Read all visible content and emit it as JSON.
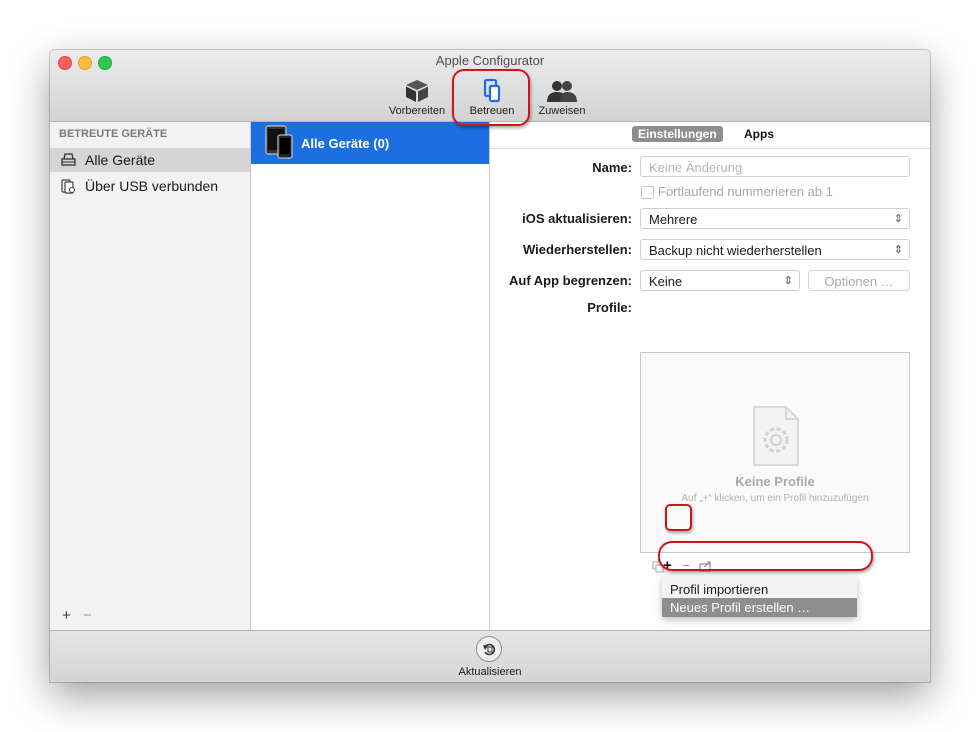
{
  "window": {
    "title": "Apple Configurator"
  },
  "toolbar": {
    "items": [
      {
        "label": "Vorbereiten",
        "icon": "cube-icon"
      },
      {
        "label": "Betreuen",
        "icon": "devices-icon",
        "active": true
      },
      {
        "label": "Zuweisen",
        "icon": "people-icon"
      }
    ]
  },
  "sidebar": {
    "header": "BETREUTE GERÄTE",
    "items": [
      {
        "label": "Alle Geräte",
        "icon": "tray-icon",
        "selected": true
      },
      {
        "label": "Über USB verbunden",
        "icon": "usb-device-icon"
      }
    ],
    "footer": {
      "add": "+",
      "remove": "−"
    }
  },
  "device_list": {
    "selected_row": {
      "label": "Alle Geräte (0)",
      "icon": "ipad-iphone-icon"
    }
  },
  "settings": {
    "tabs": [
      {
        "label": "Einstellungen",
        "selected": true
      },
      {
        "label": "Apps",
        "selected": false
      }
    ],
    "name": {
      "label": "Name:",
      "placeholder": "Keine Änderung"
    },
    "sequential": {
      "label": "Fortlaufend nummerieren ab 1",
      "checked": false
    },
    "ios_update": {
      "label": "iOS aktualisieren:",
      "value": "Mehrere"
    },
    "restore": {
      "label": "Wiederherstellen:",
      "value": "Backup nicht wiederherstellen"
    },
    "app_lock": {
      "label": "Auf App begrenzen:",
      "value": "Keine",
      "options_button": "Optionen …"
    },
    "profiles": {
      "label": "Profile:",
      "empty_title": "Keine Profile",
      "empty_hint": "Auf „+“ klicken, um ein Profil hinzuzufügen",
      "tools": {
        "add": "+",
        "remove": "−"
      }
    },
    "add_menu": {
      "items": [
        {
          "label": "Profil importieren",
          "highlighted": false
        },
        {
          "label": "Neues Profil erstellen …",
          "highlighted": true
        }
      ]
    }
  },
  "bottom_bar": {
    "refresh_label": "Aktualisieren"
  },
  "colors": {
    "accent": "#1b6fe0",
    "callout": "#d0141b",
    "menu_highlight": "#8e8e8e"
  }
}
